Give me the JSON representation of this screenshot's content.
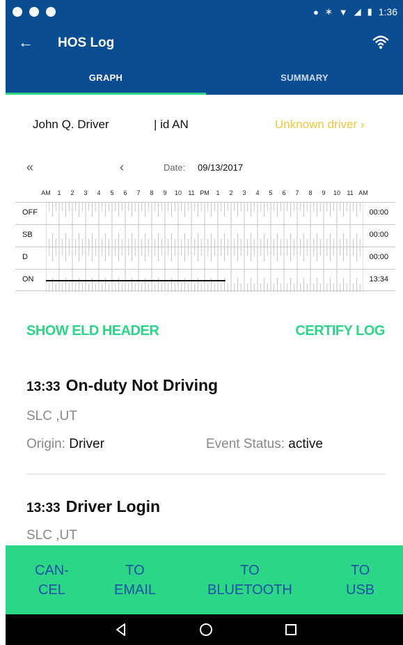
{
  "status_bar": {
    "time": "1:36",
    "left_icons": [
      "message-icon",
      "shield-icon",
      "android-icon"
    ],
    "right_icons": [
      "location-icon",
      "bluetooth-icon",
      "wifi-signal-icon",
      "no-signal-icon",
      "battery-icon"
    ]
  },
  "app_bar": {
    "title": "HOS Log",
    "back_icon": "back-arrow-icon",
    "action_icon": "wifi-icon"
  },
  "tabs": [
    {
      "label": "GRAPH",
      "active": true
    },
    {
      "label": "SUMMARY",
      "active": false
    }
  ],
  "driver": {
    "name": "John Q. Driver",
    "id": "| id AN",
    "unknown_link": "Unknown driver  ›"
  },
  "date_nav": {
    "first_glyph": "«",
    "prev_glyph": "‹",
    "label": "Date:",
    "value": "09/13/2017"
  },
  "graph": {
    "hour_labels": [
      "AM",
      "1",
      "2",
      "3",
      "4",
      "5",
      "6",
      "7",
      "8",
      "9",
      "10",
      "11",
      "PM",
      "1",
      "2",
      "3",
      "4",
      "5",
      "6",
      "7",
      "8",
      "9",
      "10",
      "11",
      "AM"
    ],
    "rows": [
      {
        "label": "OFF",
        "total": "00:00"
      },
      {
        "label": "SB",
        "total": "00:00"
      },
      {
        "label": "D",
        "total": "00:00"
      },
      {
        "label": "ON",
        "total": "13:34"
      }
    ],
    "on_duty_hours": [
      0,
      13.567
    ]
  },
  "actions": {
    "show_header": "SHOW ELD HEADER",
    "certify": "CERTIFY LOG"
  },
  "events": [
    {
      "time": "13:33",
      "type": "On-duty Not Driving",
      "location": "SLC ,UT",
      "origin_label": "Origin:",
      "origin": "Driver",
      "status_label": "Event Status:",
      "status": "active"
    },
    {
      "time": "13:33",
      "type": "Driver Login",
      "location": "SLC ,UT"
    }
  ],
  "bottom_buttons": [
    {
      "line1": "CAN-",
      "line2": "CEL"
    },
    {
      "line1": "TO",
      "line2": "EMAIL"
    },
    {
      "line1": "TO",
      "line2": "BLUETOOTH"
    },
    {
      "line1": "TO",
      "line2": "USB"
    }
  ],
  "colors": {
    "primary": "#0b4d92",
    "accent": "#2bd687",
    "warning": "#f0c83a",
    "button_text": "#1f4fa6"
  },
  "nav_icons": [
    "back-triangle-icon",
    "home-circle-icon",
    "recents-square-icon"
  ]
}
